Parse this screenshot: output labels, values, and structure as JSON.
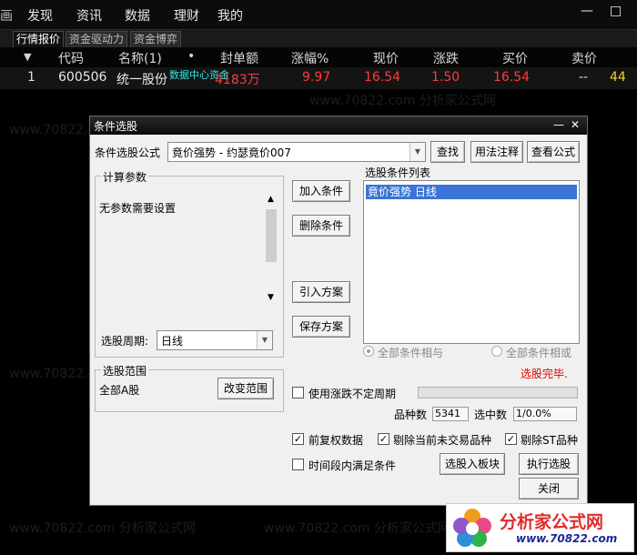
{
  "menu": {
    "items": [
      "画",
      "发现",
      "资讯",
      "数据",
      "理财",
      "我的"
    ]
  },
  "window_controls": {
    "minimize": "—",
    "restore": "□"
  },
  "tabs": [
    "行情报价",
    "资金驱动力",
    "资金博弈"
  ],
  "table": {
    "headers": {
      "arrow": "▼",
      "code": "代码",
      "name": "名称(1)",
      "dot": "•",
      "seal": "封单额",
      "pct": "涨幅%",
      "price": "现价",
      "chg": "涨跌",
      "bid": "买价",
      "ask": "卖价"
    },
    "row": {
      "index": "1",
      "code": "600506",
      "name": "统一股份",
      "overlay": "数据中心资金",
      "seal": "4183万",
      "pct": "9.97",
      "price": "16.54",
      "chg": "1.50",
      "bid": "16.54",
      "ask": "--",
      "extra": "44"
    }
  },
  "dialog": {
    "title": "条件选股",
    "formula_label": "条件选股公式",
    "formula_value": "竟价强势  -  约瑟竟价007",
    "btn_find": "查找",
    "btn_usage": "用法注释",
    "btn_view": "查看公式",
    "params_title": "计算参数",
    "params_text": "无参数需要设置",
    "period_label": "选股周期:",
    "period_value": "日线",
    "btn_add": "加入条件",
    "btn_delete": "删除条件",
    "btn_import": "引入方案",
    "btn_save": "保存方案",
    "list_title": "选股条件列表",
    "list_items": [
      "竟价强势  日线"
    ],
    "radio_and": "全部条件相与",
    "radio_or": "全部条件相或",
    "status": "选股完毕.",
    "range_title": "选股范围",
    "range_value": "全部A股",
    "btn_change_range": "改变范围",
    "chk_uncertain": "使用涨跌不定周期",
    "count_label": "品种数",
    "count_value": "5341",
    "selected_label": "选中数",
    "selected_value": "1/0.0%",
    "chk_prerights": "前复权数据",
    "chk_notrade": "剔除当前未交易品种",
    "chk_st": "剔除ST品种",
    "chk_period": "时间段内满足条件",
    "btn_to_block": "选股入板块",
    "btn_execute": "执行选股",
    "btn_close": "关闭"
  },
  "watermark": {
    "text": "www.70822.com 分析家公式网"
  },
  "logo": {
    "title": "分析家公式网",
    "url": "www.70822.com"
  },
  "colors": {
    "up": "#ff3b3b",
    "cyan": "#37e3e3",
    "yellow": "#f2d23a",
    "select": "#3a74d4",
    "status": "#e00000"
  }
}
